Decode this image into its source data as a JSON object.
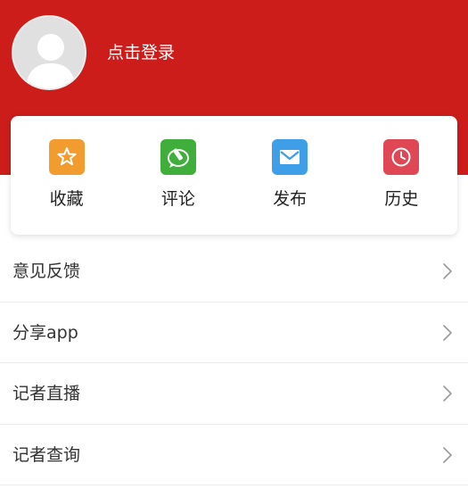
{
  "header": {
    "login_label": "点击登录",
    "background_color": "#cc1d1b"
  },
  "shortcuts": [
    {
      "label": "收藏",
      "icon": "star-icon",
      "color": "#f29b2f"
    },
    {
      "label": "评论",
      "icon": "comment-pencil-icon",
      "color": "#3fae3b"
    },
    {
      "label": "发布",
      "icon": "mail-icon",
      "color": "#3e9ee8"
    },
    {
      "label": "历史",
      "icon": "clock-icon",
      "color": "#e04755"
    }
  ],
  "menu": {
    "items": [
      {
        "label": "意见反馈"
      },
      {
        "label": "分享app"
      },
      {
        "label": "记者直播"
      },
      {
        "label": "记者查询"
      }
    ]
  }
}
